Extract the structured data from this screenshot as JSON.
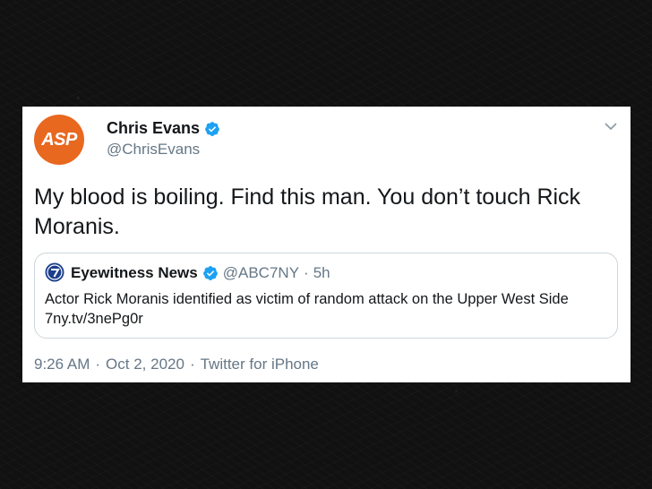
{
  "tweet": {
    "author_name": "Chris Evans",
    "author_handle": "@ChrisEvans",
    "avatar_text": "ASP",
    "text": "My blood is boiling. Find this man. You don’t touch Rick Moranis.",
    "time": "9:26 AM",
    "separator": "·",
    "date": "Oct 2, 2020",
    "source": "Twitter for iPhone"
  },
  "quoted": {
    "author_name": "Eyewitness News",
    "author_handle": "@ABC7NY",
    "separator": "·",
    "age": "5h",
    "text": "Actor Rick Moranis identified as victim of random attack on the Upper West Side 7ny.tv/3nePg0r"
  },
  "colors": {
    "avatar_bg": "#e8681f",
    "verified_blue": "#1da1f2",
    "secondary_text": "#657786"
  },
  "icons": [
    "verified-badge-icon",
    "chevron-down-icon",
    "abc7-logo-icon"
  ]
}
